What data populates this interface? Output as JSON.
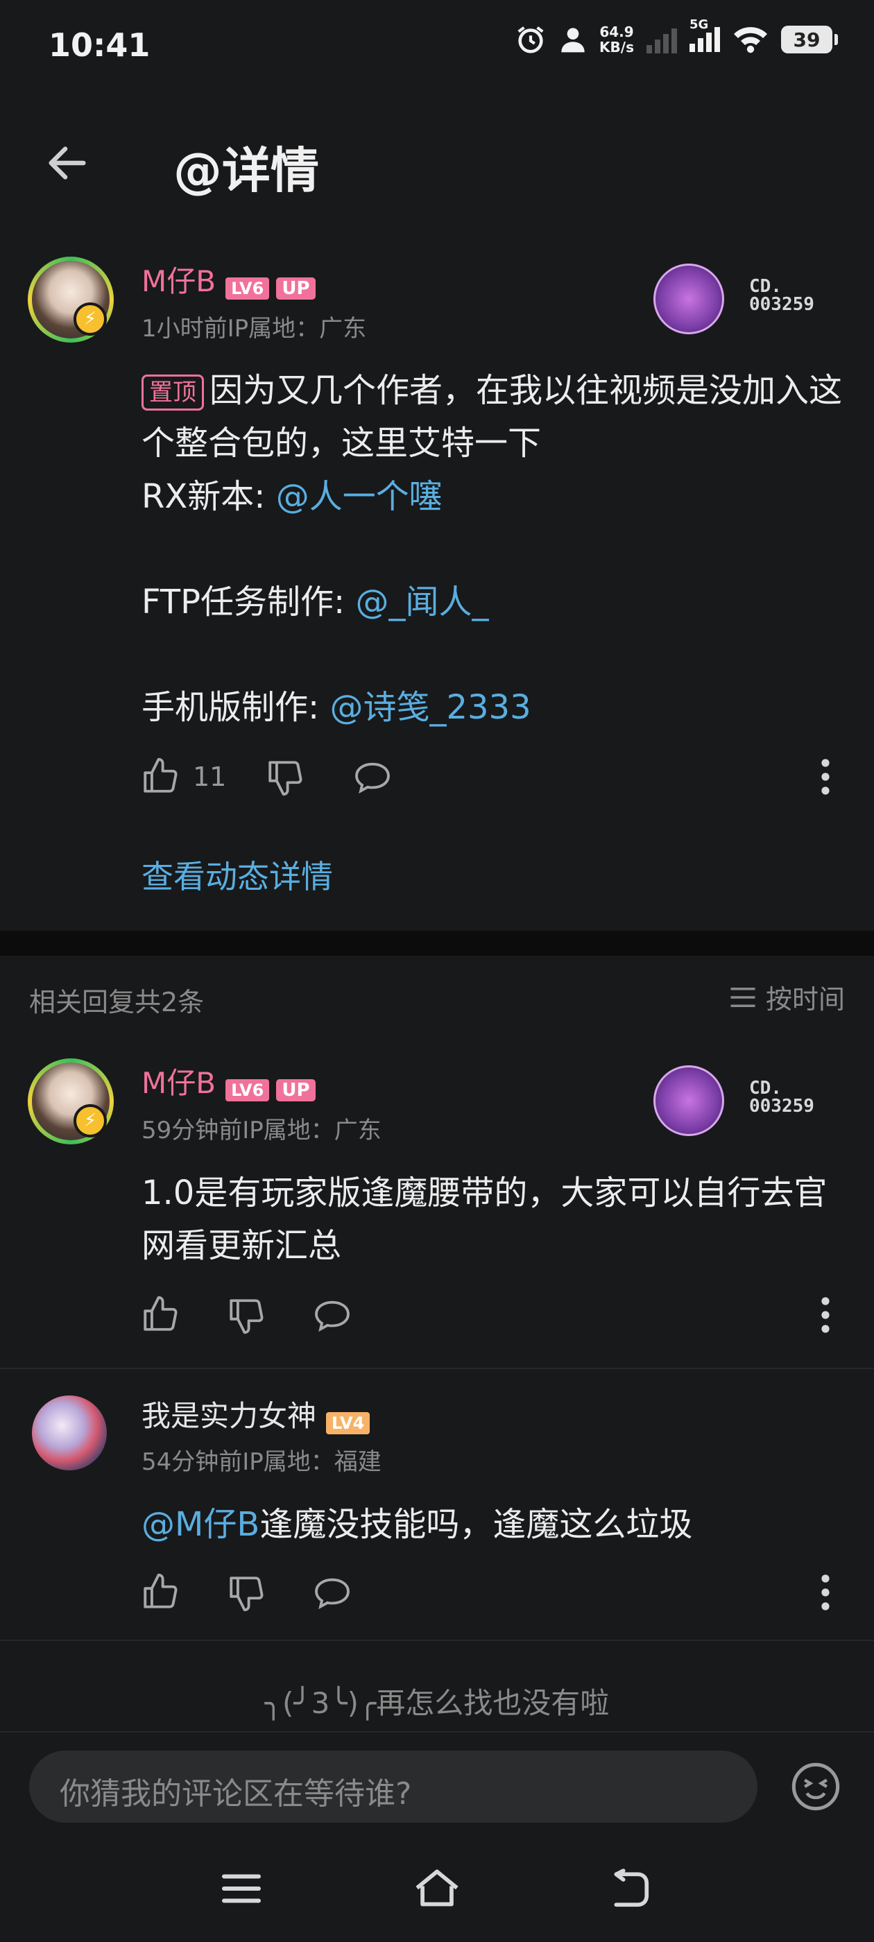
{
  "status_bar": {
    "time": "10:41",
    "net_speed_value": "64.9",
    "net_speed_unit": "KB/s",
    "network": "5G",
    "battery": "39"
  },
  "header": {
    "title": "@详情"
  },
  "main_comment": {
    "user": "M仔B",
    "level": "LV6",
    "up_tag": "UP",
    "meta": "1小时前IP属地：广东",
    "badge_no_line1": "CD.",
    "badge_no_line2": "003259",
    "pin_label": "置顶",
    "text_line1": "因为又几个作者，在我以往视频是没加入这个整合包的，这里艾特一下",
    "rx_label": "RX新本:",
    "rx_mention": "@人一个噻",
    "ftp_label": "FTP任务制作:",
    "ftp_mention": "@_闻人_",
    "mobile_label": "手机版制作:",
    "mobile_mention": "@诗笺_2333",
    "likes": "11",
    "view_link": "查看动态详情"
  },
  "replies_header": {
    "count_label": "相关回复共2条",
    "sort_label": "按时间"
  },
  "replies": [
    {
      "user": "M仔B",
      "level": "LV6",
      "up_tag": "UP",
      "meta": "59分钟前IP属地：广东",
      "badge_no_line1": "CD.",
      "badge_no_line2": "003259",
      "text": "1.0是有玩家版逢魔腰带的，大家可以自行去官网看更新汇总"
    },
    {
      "user": "我是实力女神",
      "level": "LV4",
      "meta": "54分钟前IP属地：福建",
      "mention": "@M仔B",
      "text": "逢魔没技能吗，逢魔这么垃圾"
    }
  ],
  "end_text": "╮(╯3╰)╭再怎么找也没有啦",
  "input": {
    "placeholder": "你猜我的评论区在等待谁?"
  },
  "colors": {
    "background": "#18191b",
    "accent_pink": "#f0729a",
    "link_blue": "#5aaee0",
    "meta_gray": "#8a8a8a"
  }
}
